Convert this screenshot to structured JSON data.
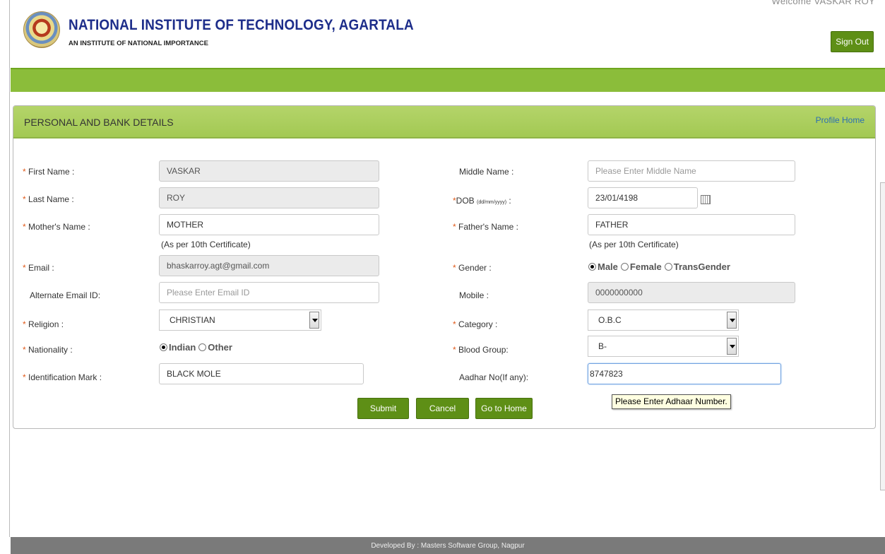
{
  "header": {
    "institute_name": "NATIONAL INSTITUTE OF TECHNOLOGY, AGARTALA",
    "institute_subtitle": "AN INSTITUTE OF NATIONAL IMPORTANCE",
    "welcome": "Welcome VASKAR ROY",
    "sign_out": "Sign Out"
  },
  "panel": {
    "title": "PERSONAL AND BANK DETAILS",
    "profile_home": "Profile Home"
  },
  "form": {
    "first_name_label": "First Name :",
    "first_name_value": "VASKAR",
    "middle_name_label": "Middle Name :",
    "middle_name_placeholder": "Please Enter Middle Name",
    "last_name_label": "Last Name :",
    "last_name_value": "ROY",
    "dob_label": "DOB",
    "dob_format": "(dd/mm/yyyy)",
    "dob_colon": " :",
    "dob_value": "23/01/4198",
    "mother_label": "Mother's Name :",
    "mother_value": "MOTHER",
    "father_label": "Father's Name :",
    "father_value": "FATHER",
    "as_per_note": "(As per 10th Certificate)",
    "email_label": "Email :",
    "email_value": "bhaskarroy.agt@gmail.com",
    "gender_label": "Gender :",
    "gender_options": [
      "Male",
      "Female",
      "TransGender"
    ],
    "alt_email_label": "Alternate Email ID:",
    "alt_email_placeholder": "Please Enter Email ID",
    "mobile_label": "Mobile :",
    "mobile_value": "0000000000",
    "religion_label": "Religion :",
    "religion_value": "CHRISTIAN",
    "category_label": "Category :",
    "category_value": "O.B.C",
    "nationality_label": "Nationality :",
    "nationality_options": [
      "Indian",
      "Other"
    ],
    "blood_group_label": "Blood Group:",
    "blood_group_value": "B-",
    "id_mark_label": "Identification Mark :",
    "id_mark_value": "BLACK MOLE",
    "aadhar_label": "Aadhar No(If any):",
    "aadhar_value": "8747823",
    "required_marker": "*"
  },
  "buttons": {
    "submit": "Submit",
    "cancel": "Cancel",
    "go_home": "Go to Home"
  },
  "tooltip": "Please Enter Adhaar Number.",
  "footer": "Developed By : Masters Software Group, Nagpur"
}
